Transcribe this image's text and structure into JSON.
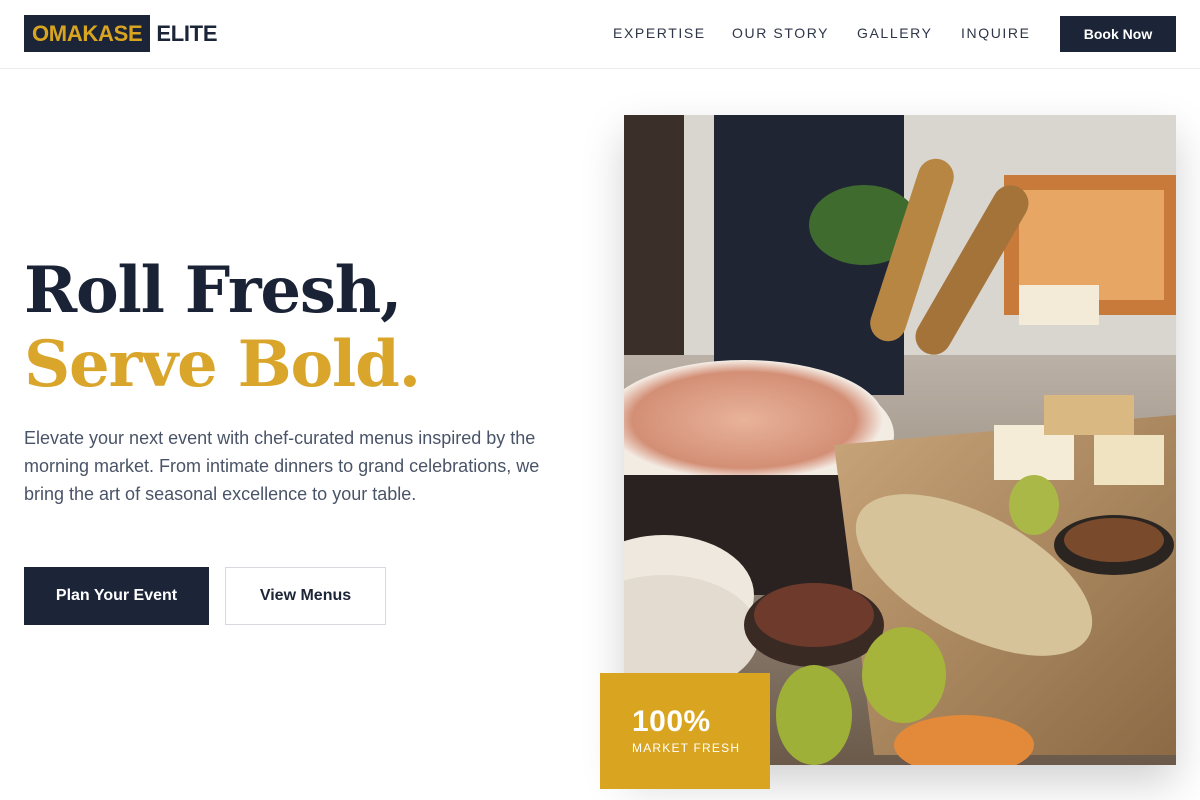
{
  "brand": {
    "name_highlight": "OMAKASE",
    "name_rest": "ELITE"
  },
  "nav": {
    "items": [
      {
        "label": "EXPERTISE"
      },
      {
        "label": "OUR STORY"
      },
      {
        "label": "GALLERY"
      },
      {
        "label": "INQUIRE"
      }
    ],
    "cta_label": "Book Now"
  },
  "hero": {
    "title_line1": "Roll Fresh,",
    "title_line2": "Serve Bold.",
    "description": "Elevate your next event with chef-curated menus inspired by the morning market. From intimate dinners to grand celebrations, we bring the art of seasonal excellence to your table.",
    "primary_button": "Plan Your Event",
    "secondary_button": "View Menus"
  },
  "stat": {
    "value": "100%",
    "label": "MARKET FRESH"
  },
  "colors": {
    "navy": "#1c2538",
    "gold": "#d9a520",
    "text_muted": "#4a5468"
  },
  "image": {
    "icon": "catering-buffet-photo"
  }
}
